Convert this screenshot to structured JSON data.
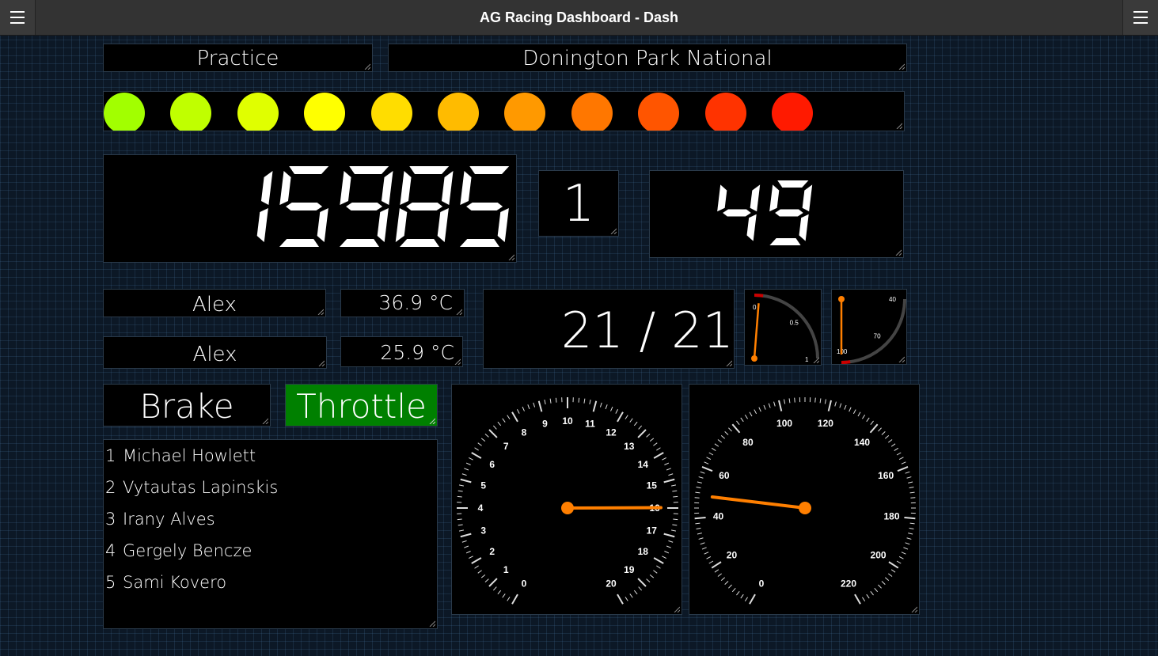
{
  "app": {
    "title": "AG Racing Dashboard - Dash"
  },
  "session": {
    "type": "Practice",
    "track": "Donington Park National"
  },
  "shift_lights": {
    "colors": [
      "#a2ff00",
      "#c0ff00",
      "#e0ff00",
      "#ffff00",
      "#ffdd00",
      "#ffbb00",
      "#ff9900",
      "#ff7700",
      "#ff5500",
      "#ff3300",
      "#ff1a00"
    ]
  },
  "engine": {
    "rpm": "15985",
    "gear": "1",
    "speed": "49"
  },
  "drivers": [
    {
      "name": "Alex",
      "temp": "36.9 °C"
    },
    {
      "name": "Alex",
      "temp": "25.9 °C"
    }
  ],
  "position": {
    "value": "21 / 21"
  },
  "small_gauge_1": {
    "labels": [
      "0",
      "0.5",
      "1"
    ],
    "value": 0.05
  },
  "small_gauge_2": {
    "labels": [
      "40",
      "70",
      "100"
    ],
    "value": 100
  },
  "pedals": {
    "brake": "Brake",
    "throttle": "Throttle",
    "throttle_active_color": "#008000"
  },
  "leaderboard": [
    {
      "pos": "1",
      "name": "Michael Howlett"
    },
    {
      "pos": "2",
      "name": "Vytautas Lapinskis"
    },
    {
      "pos": "3",
      "name": "Irany Alves"
    },
    {
      "pos": "4",
      "name": "Gergely Bencze"
    },
    {
      "pos": "5",
      "name": "Sami Kovero"
    }
  ],
  "rpm_gauge": {
    "labels": [
      "0",
      "1",
      "2",
      "3",
      "4",
      "5",
      "6",
      "7",
      "8",
      "9",
      "10",
      "11",
      "12",
      "13",
      "14",
      "15",
      "16",
      "17",
      "18",
      "19",
      "20"
    ],
    "value": 15.985
  },
  "speed_gauge": {
    "labels": [
      "0",
      "20",
      "40",
      "60",
      "80",
      "100",
      "120",
      "140",
      "160",
      "180",
      "200",
      "220"
    ],
    "value": 49
  },
  "needle_color": "#ff7f00"
}
